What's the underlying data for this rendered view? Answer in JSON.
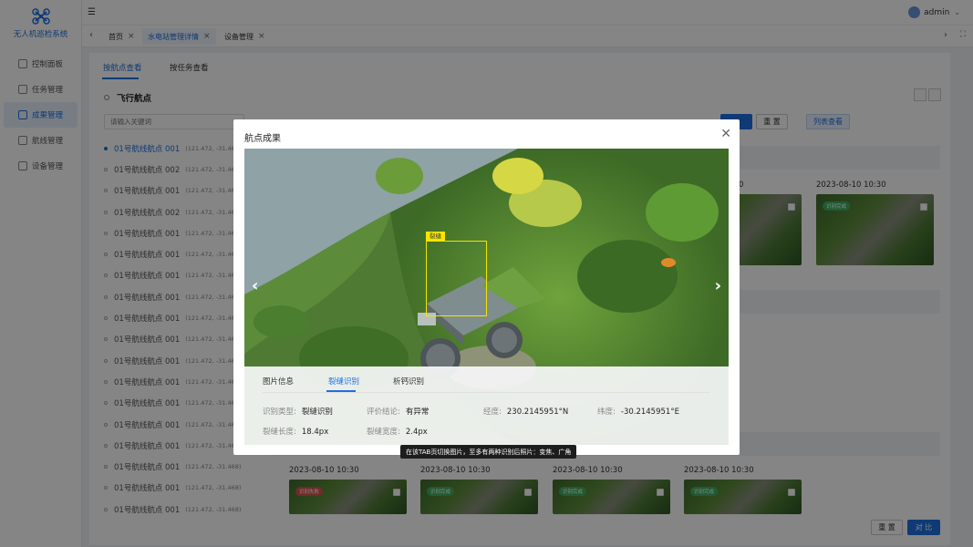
{
  "app": {
    "name": "无人机巡检系统"
  },
  "sidebar": {
    "items": [
      {
        "label": "控制面板",
        "icon": "dashboard-icon"
      },
      {
        "label": "任务管理",
        "icon": "task-icon"
      },
      {
        "label": "成果管理",
        "icon": "result-icon",
        "active": true
      },
      {
        "label": "航线管理",
        "icon": "route-icon"
      },
      {
        "label": "设备管理",
        "icon": "device-icon"
      }
    ]
  },
  "topbar": {
    "user": "admin"
  },
  "tabs": [
    {
      "label": "首页"
    },
    {
      "label": "水电站管理详情",
      "active": true
    },
    {
      "label": "设备管理"
    }
  ],
  "content": {
    "subtabs": [
      {
        "label": "按航点查看",
        "active": true
      },
      {
        "label": "按任务查看"
      }
    ],
    "section_title": "飞行航点",
    "search_placeholder": "请输入关键词",
    "waypoints": [
      {
        "name": "01号航线航点 001",
        "coord": "(121.472, -31.468)",
        "active": true
      },
      {
        "name": "01号航线航点 002",
        "coord": "(121.472, -31.468)"
      },
      {
        "name": "01号航线航点 001",
        "coord": "(121.472, -31.468)"
      },
      {
        "name": "01号航线航点 002",
        "coord": "(121.472, -31.468)"
      },
      {
        "name": "01号航线航点 001",
        "coord": "(121.472, -31.468)"
      },
      {
        "name": "01号航线航点 001",
        "coord": "(121.472, -31.468)"
      },
      {
        "name": "01号航线航点 001",
        "coord": "(121.472, -31.468)"
      },
      {
        "name": "01号航线航点 001",
        "coord": "(121.472, -31.468)"
      },
      {
        "name": "01号航线航点 001",
        "coord": "(121.472, -31.468)"
      },
      {
        "name": "01号航线航点 001",
        "coord": "(121.472, -31.468)"
      },
      {
        "name": "01号航线航点 001",
        "coord": "(121.472, -31.468)"
      },
      {
        "name": "01号航线航点 001",
        "coord": "(121.472, -31.468)"
      },
      {
        "name": "01号航线航点 001",
        "coord": "(121.472, -31.468)"
      },
      {
        "name": "01号航线航点 001",
        "coord": "(121.472, -31.468)"
      },
      {
        "name": "01号航线航点 001",
        "coord": "(121.472, -31.468)"
      },
      {
        "name": "01号航线航点 001",
        "coord": "(121.472, -31.468)"
      },
      {
        "name": "01号航线航点 001",
        "coord": "(121.472, -31.468)"
      },
      {
        "name": "01号航线航点 001",
        "coord": "(121.472, -31.468)"
      }
    ],
    "reset_label": "重 置",
    "list_view_label": "列表查看",
    "top_timestamps": [
      "0",
      "2023-08-10 10:30"
    ],
    "bottom_timestamps": [
      "2023-08-10 10:30",
      "2023-08-10 10:30",
      "2023-08-10 10:30",
      "2023-08-10 10:30"
    ],
    "thumb_tags": {
      "normal": "识别完成",
      "error": "识别失败"
    },
    "footer": {
      "reset": "重 置",
      "compare": "对 比"
    }
  },
  "modal": {
    "title": "航点成果",
    "detection_label": "裂缝",
    "tabs": [
      {
        "label": "图片信息"
      },
      {
        "label": "裂缝识别",
        "active": true
      },
      {
        "label": "析钙识别"
      }
    ],
    "fields": {
      "type_label": "识别类型:",
      "type_value": "裂縫识别",
      "eval_label": "评价结论:",
      "eval_value": "有异常",
      "lon_label": "经度:",
      "lon_value": "230.2145951°N",
      "lat_label": "纬度:",
      "lat_value": "-30.2145951°E",
      "len_label": "裂缝长度:",
      "len_value": "18.4px",
      "width_label": "裂缝宽度:",
      "width_value": "2.4px"
    },
    "tooltip": "在该TAB页切换图片，至多有两种识别后照片：变焦、广角"
  },
  "colors": {
    "primary": "#1e6fe0",
    "detection": "#f6e400",
    "tag_ok": "#3fae5e",
    "tag_fail": "#d9534f"
  }
}
